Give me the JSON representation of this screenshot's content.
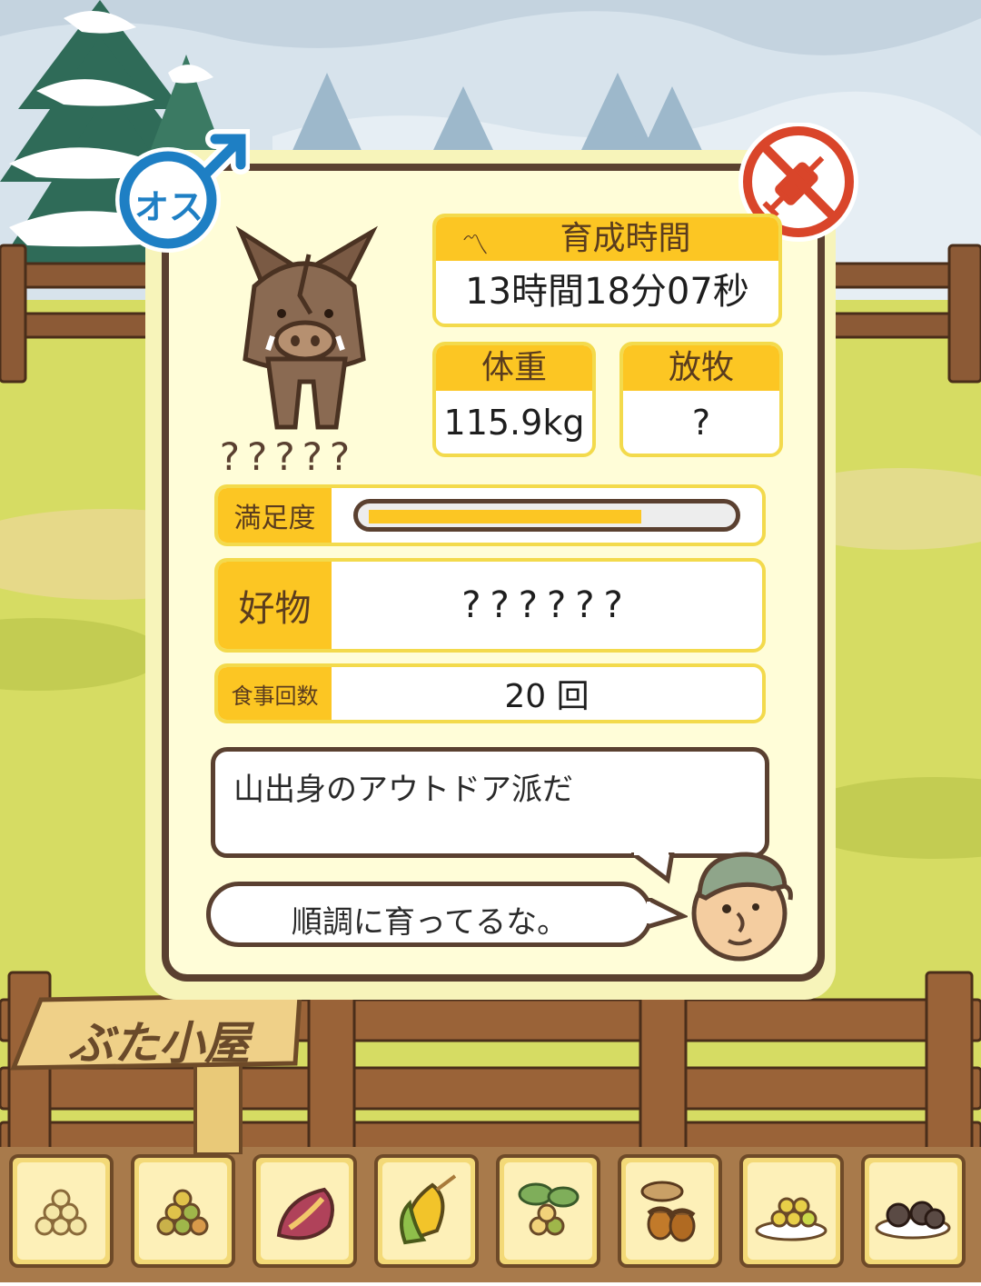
{
  "badges": {
    "gender_label": "オス",
    "gender_color": "#1e7fc4",
    "vaccine_color": "#d9452a"
  },
  "pig": {
    "name": "?????"
  },
  "stats": {
    "raise_time": {
      "label": "育成時間",
      "value": "13時間18分07秒"
    },
    "weight": {
      "label": "体重",
      "value": "115.9kg"
    },
    "grazing": {
      "label": "放牧",
      "value": "?"
    },
    "satisfaction": {
      "label": "満足度",
      "fraction": 0.75
    },
    "favorite": {
      "label": "好物",
      "value": "??????"
    },
    "meals": {
      "label": "食事回数",
      "value": "20 回"
    }
  },
  "dialog": {
    "description": "山出身のアウトドア派だ",
    "farmer_comment": "順調に育ってるな。"
  },
  "sign": {
    "title": "ぶた小屋"
  },
  "food_bar": [
    {
      "icon": "soybeans-icon"
    },
    {
      "icon": "mixed-beans-icon"
    },
    {
      "icon": "sweet-potato-icon"
    },
    {
      "icon": "corn-icon"
    },
    {
      "icon": "leafy-berries-icon"
    },
    {
      "icon": "acorns-icon"
    },
    {
      "icon": "grain-plate-icon"
    },
    {
      "icon": "dark-balls-plate-icon"
    }
  ],
  "colors": {
    "sky": "#d8e4ec",
    "grass": "#d7dd66",
    "accent_yellow": "#fcc623",
    "frame_brown": "#5a4030"
  }
}
